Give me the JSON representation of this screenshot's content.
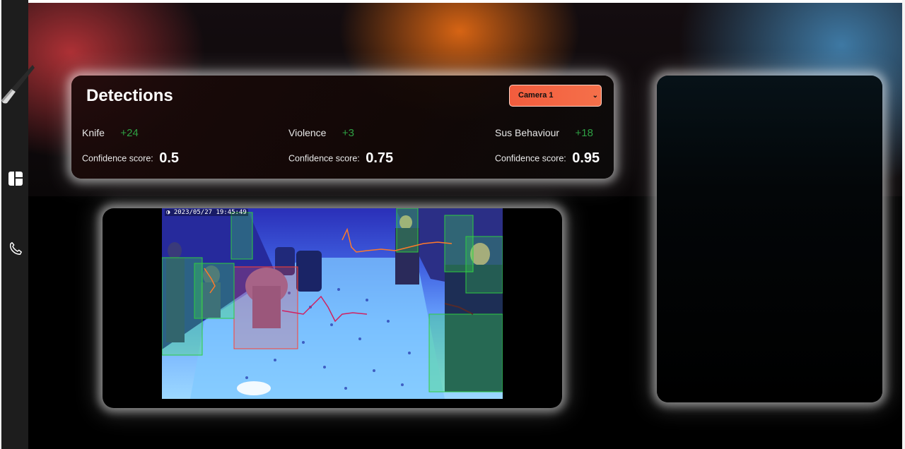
{
  "sidebar": {
    "icons": [
      "knife-logo",
      "dashboard-icon",
      "phone-icon"
    ]
  },
  "detections": {
    "title": "Detections",
    "camera_select": {
      "selected": "Camera 1"
    },
    "metrics": [
      {
        "name": "Knife",
        "delta": "+24",
        "confidence_label": "Confidence score:",
        "confidence": "0.5"
      },
      {
        "name": "Violence",
        "delta": "+3",
        "confidence_label": "Confidence score:",
        "confidence": "0.75"
      },
      {
        "name": "Sus Behaviour",
        "delta": "+18",
        "confidence_label": "Confidence score:",
        "confidence": "0.95"
      }
    ]
  },
  "video": {
    "timestamp": "2023/05/27 19:45:49"
  },
  "colors": {
    "accent_select": "#f25c3d",
    "delta_green": "#2ea043",
    "glow": "#ffffff"
  }
}
